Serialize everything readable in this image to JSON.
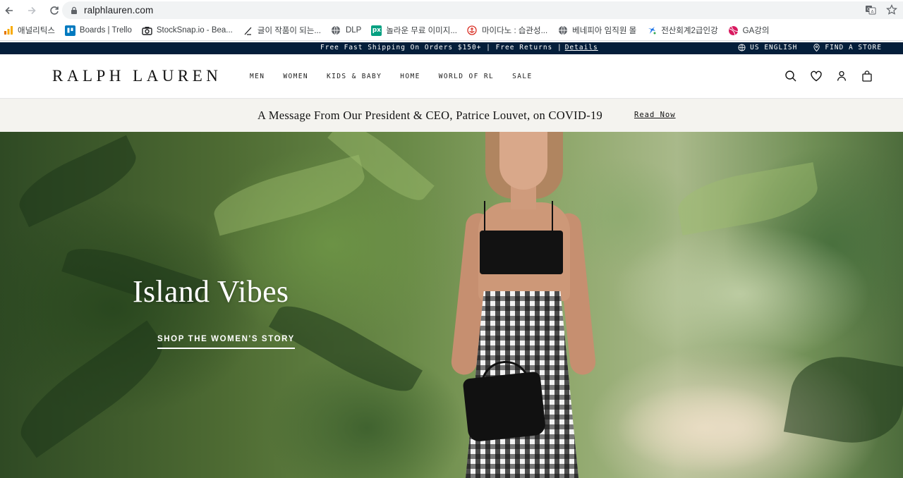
{
  "browser": {
    "url": "ralphlauren.com",
    "bookmarks": [
      {
        "label": "애널리틱스",
        "icon": "analytics-icon",
        "color": "#f9ab00"
      },
      {
        "label": "Boards | Trello",
        "icon": "trello-icon",
        "color": "#0079bf"
      },
      {
        "label": "StockSnap.io - Bea...",
        "icon": "camera-icon",
        "color": "#202124"
      },
      {
        "label": "글이 작품이 되는...",
        "icon": "pen-icon",
        "color": "#202124"
      },
      {
        "label": "DLP",
        "icon": "globe-icon",
        "color": "#5f6368"
      },
      {
        "label": "놀라운 무료 이미지...",
        "icon": "pexels-icon",
        "color": "#05a081"
      },
      {
        "label": "마이다노 : 습관성...",
        "icon": "anchor-icon",
        "color": "#d93025"
      },
      {
        "label": "베네피아 임직원 몰",
        "icon": "globe-icon",
        "color": "#5f6368"
      },
      {
        "label": "전산회계2급인강",
        "icon": "star-logo-icon",
        "color": "#1a73e8"
      },
      {
        "label": "GA강의",
        "icon": "ball-icon",
        "color": "#d81b60"
      }
    ]
  },
  "promo": {
    "text": "Free Fast Shipping On Orders $150+ | Free Returns |",
    "details": "Details",
    "language": "US ENGLISH",
    "store": "FIND A STORE"
  },
  "header": {
    "logo": "RALPH LAUREN",
    "nav": [
      "MEN",
      "WOMEN",
      "KIDS & BABY",
      "HOME",
      "WORLD OF RL",
      "SALE"
    ]
  },
  "announcement": {
    "message": "A Message From Our President & CEO, Patrice Louvet, on COVID-19",
    "link": "Read Now"
  },
  "hero": {
    "title": "Island Vibes",
    "cta": "SHOP THE WOMEN'S STORY"
  }
}
